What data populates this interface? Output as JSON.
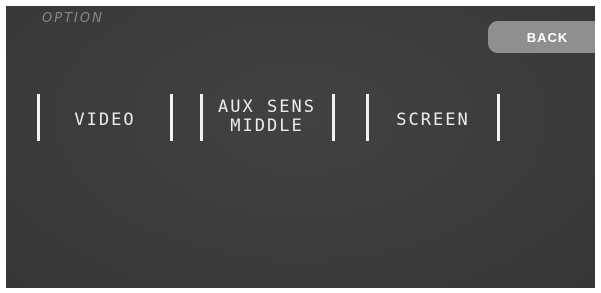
{
  "header": {
    "title": "OPTION",
    "back_label": "BACK"
  },
  "menu": {
    "items": [
      {
        "lines": [
          "VIDEO"
        ]
      },
      {
        "lines": [
          "AUX SENS",
          "MIDDLE"
        ]
      },
      {
        "lines": [
          "SCREEN"
        ]
      }
    ]
  },
  "colors": {
    "background": "#3a3a3a",
    "text": "#ececec",
    "title": "#8a8a8a",
    "back_button": "#8f8f8f"
  }
}
